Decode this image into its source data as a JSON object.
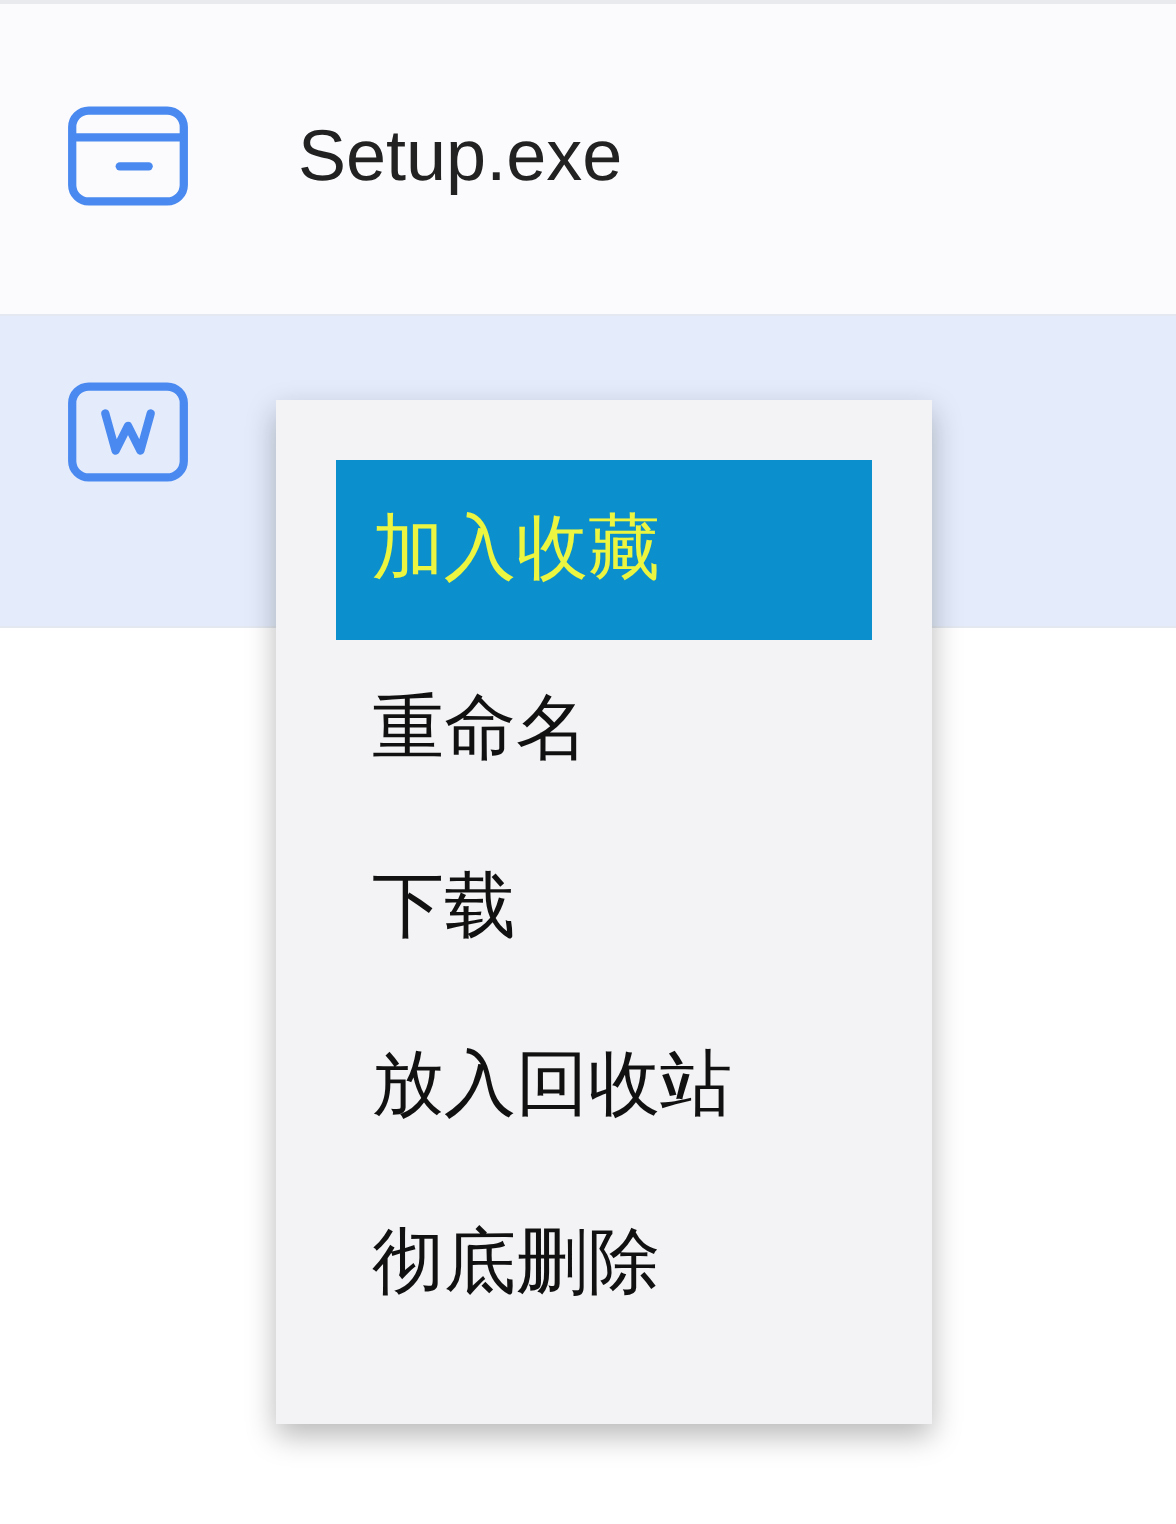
{
  "files": [
    {
      "kind": "exe",
      "name": "Setup.exe",
      "selected": false
    },
    {
      "kind": "word",
      "selected": true
    }
  ],
  "context_menu": {
    "items": [
      {
        "label": "加入收藏",
        "selected": true
      },
      {
        "label": "重命名",
        "selected": false
      },
      {
        "label": "下载",
        "selected": false
      },
      {
        "label": "放入回收站",
        "selected": false
      },
      {
        "label": "彻底删除",
        "selected": false
      }
    ]
  }
}
